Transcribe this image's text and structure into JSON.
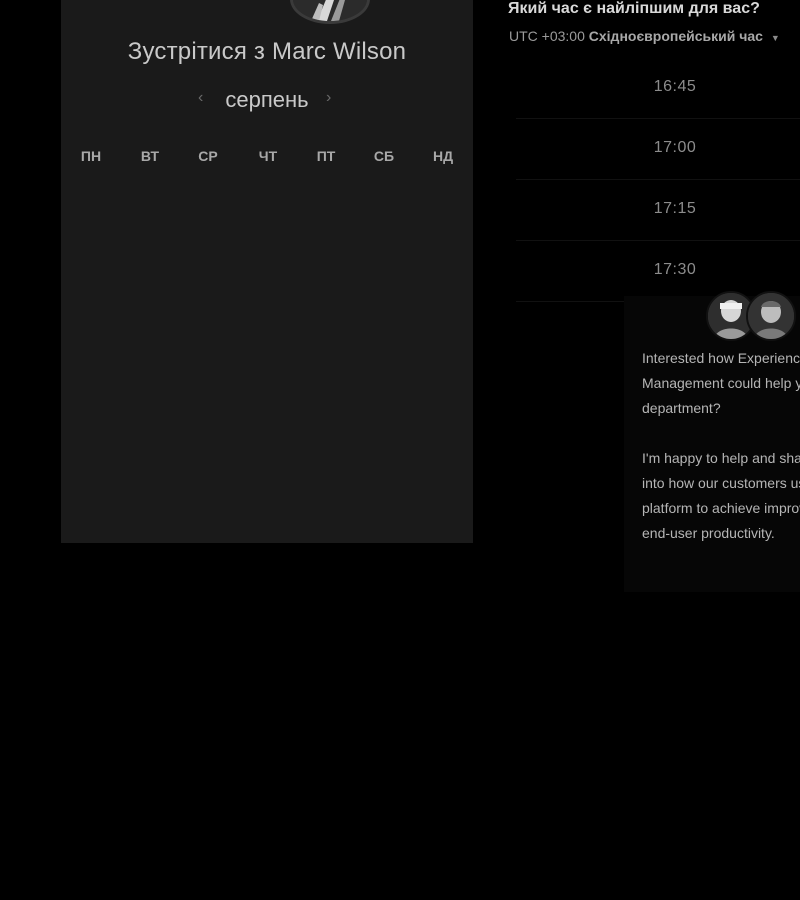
{
  "calendar": {
    "title": "Зустрітися з Marc Wilson",
    "month": "серпень",
    "prev_icon": "chevron-left-icon",
    "next_icon": "chevron-right-icon",
    "weekdays": [
      "ПН",
      "ВТ",
      "СР",
      "ЧТ",
      "ПТ",
      "СБ",
      "НД"
    ]
  },
  "time_panel": {
    "heading": "Який час є найліпшим для вас?",
    "timezone_offset": "UTC +03:00",
    "timezone_name": "Східноєвропейський час",
    "timezone_caret_icon": "caret-down-icon",
    "slots": [
      "16:45",
      "17:00",
      "17:15",
      "17:30"
    ]
  },
  "chat": {
    "message_1": "Interested how Experience Management could help your IT department?",
    "message_2": "I'm happy to help and share insight into how our customers use our platform to achieve improvement in IT end-user productivity."
  },
  "colors": {
    "background": "#000000",
    "card": "#1a1a1a",
    "text": "#c9c9c9",
    "muted": "#8c8c8c"
  }
}
